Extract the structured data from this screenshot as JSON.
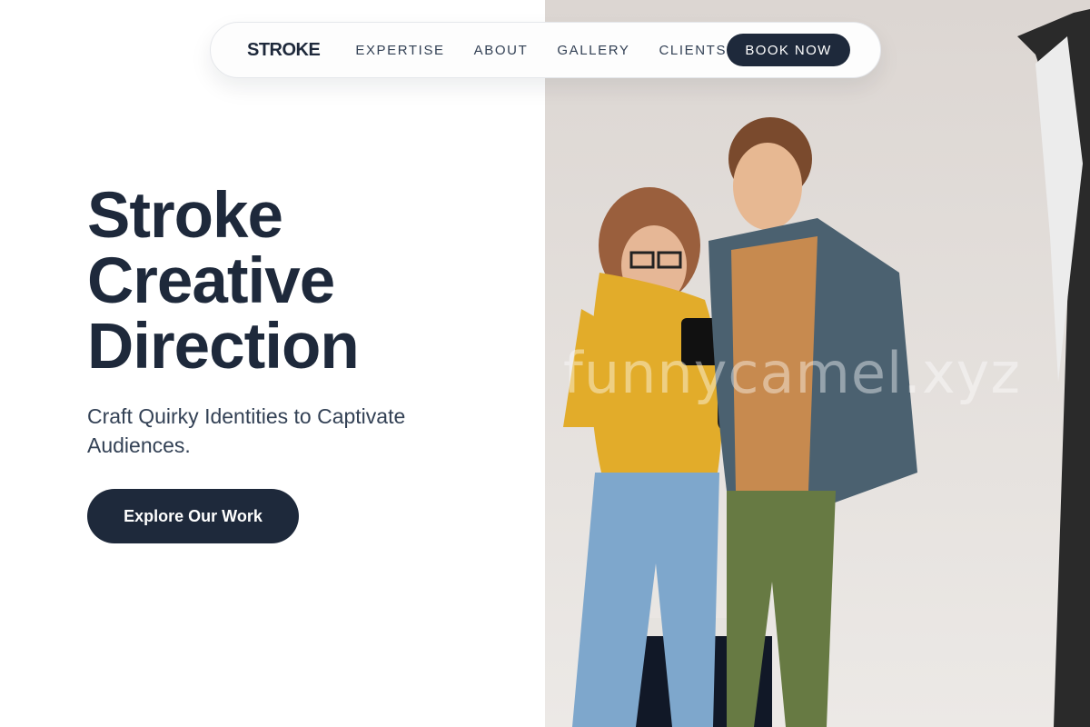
{
  "nav": {
    "logo": "STROKE",
    "links": [
      "EXPERTISE",
      "ABOUT",
      "GALLERY",
      "CLIENTS"
    ],
    "cta": "BOOK NOW"
  },
  "hero": {
    "title_lines": [
      "Stroke",
      "Creative",
      "Direction"
    ],
    "subtitle": "Craft Quirky Identities to Captivate Audiences.",
    "cta": "Explore Our Work"
  },
  "photo": {
    "description": "photographer couple reviewing camera",
    "watermark": "funnycamel.xyz"
  },
  "colors": {
    "primary": "#1e293b",
    "background": "#ffffff",
    "photo_wall": "#e9e6e3",
    "sweater": "#e2ac2a",
    "jeans": "#7ea7cc"
  }
}
